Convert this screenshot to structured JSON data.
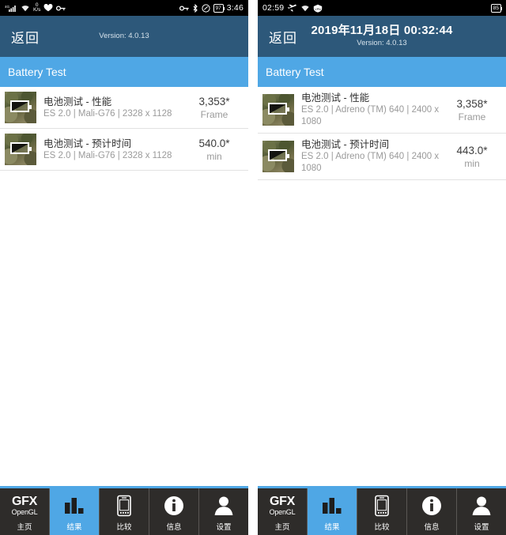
{
  "left": {
    "statusbar": {
      "network_label": "4G",
      "data_rate_value": "0",
      "data_rate_unit": "K/s",
      "icons_left": [
        "signal-icon",
        "wifi-icon",
        "data-rate-icon",
        "heart-icon",
        "key-icon"
      ],
      "icons_right": [
        "key-icon",
        "bluetooth-icon",
        "dnd-icon"
      ],
      "battery_level": "97",
      "time": "3:46"
    },
    "titlebar": {
      "back_label": "返回",
      "date": "",
      "version": "Version: 4.0.13"
    },
    "section_title": "Battery Test",
    "rows": [
      {
        "thumb": "battery-test-thumbnail",
        "title": "电池测试 - 性能",
        "subtitle": "ES 2.0 | Mali-G76 | 2328 x 1128",
        "score": "3,353*",
        "unit": "Frame"
      },
      {
        "thumb": "battery-test-thumbnail",
        "title": "电池测试 - 预计时间",
        "subtitle": "ES 2.0 | Mali-G76 | 2328 x 1128",
        "score": "540.0*",
        "unit": "min"
      }
    ],
    "nav": [
      {
        "icon": "gfx-opengl-logo",
        "logo_line1": "GFX",
        "logo_line2": "OpenGL",
        "label": "主页",
        "active": false
      },
      {
        "icon": "bar-chart-icon",
        "label": "结果",
        "active": true
      },
      {
        "icon": "phone-icon",
        "label": "比较",
        "active": false
      },
      {
        "icon": "info-icon",
        "label": "信息",
        "active": false
      },
      {
        "icon": "person-icon",
        "label": "设置",
        "active": false
      }
    ]
  },
  "right": {
    "statusbar": {
      "time": "02:59",
      "icons_left": [
        "airplane-icon",
        "wifi-icon",
        "vpn-icon"
      ],
      "battery_level": "85"
    },
    "titlebar": {
      "back_label": "返回",
      "date": "2019年11月18日 00:32:44",
      "version": "Version: 4.0.13"
    },
    "section_title": "Battery Test",
    "rows": [
      {
        "thumb": "battery-test-thumbnail",
        "title": "电池测试 - 性能",
        "subtitle": "ES 2.0 | Adreno (TM) 640 | 2400 x 1080",
        "score": "3,358*",
        "unit": "Frame"
      },
      {
        "thumb": "battery-test-thumbnail",
        "title": "电池测试 - 预计时间",
        "subtitle": "ES 2.0 | Adreno (TM) 640 | 2400 x 1080",
        "score": "443.0*",
        "unit": "min"
      }
    ],
    "nav": [
      {
        "icon": "gfx-opengl-logo",
        "logo_line1": "GFX",
        "logo_line2": "OpenGL",
        "label": "主页",
        "active": false
      },
      {
        "icon": "bar-chart-icon",
        "label": "结果",
        "active": true
      },
      {
        "icon": "phone-icon",
        "label": "比较",
        "active": false
      },
      {
        "icon": "info-icon",
        "label": "信息",
        "active": false
      },
      {
        "icon": "person-icon",
        "label": "设置",
        "active": false
      }
    ]
  },
  "colors": {
    "titlebar": "#2d587a",
    "section_header": "#4fa7e5",
    "nav_background": "#2e2c2a",
    "nav_active": "#4fa7e5",
    "statusbar": "#000000"
  }
}
